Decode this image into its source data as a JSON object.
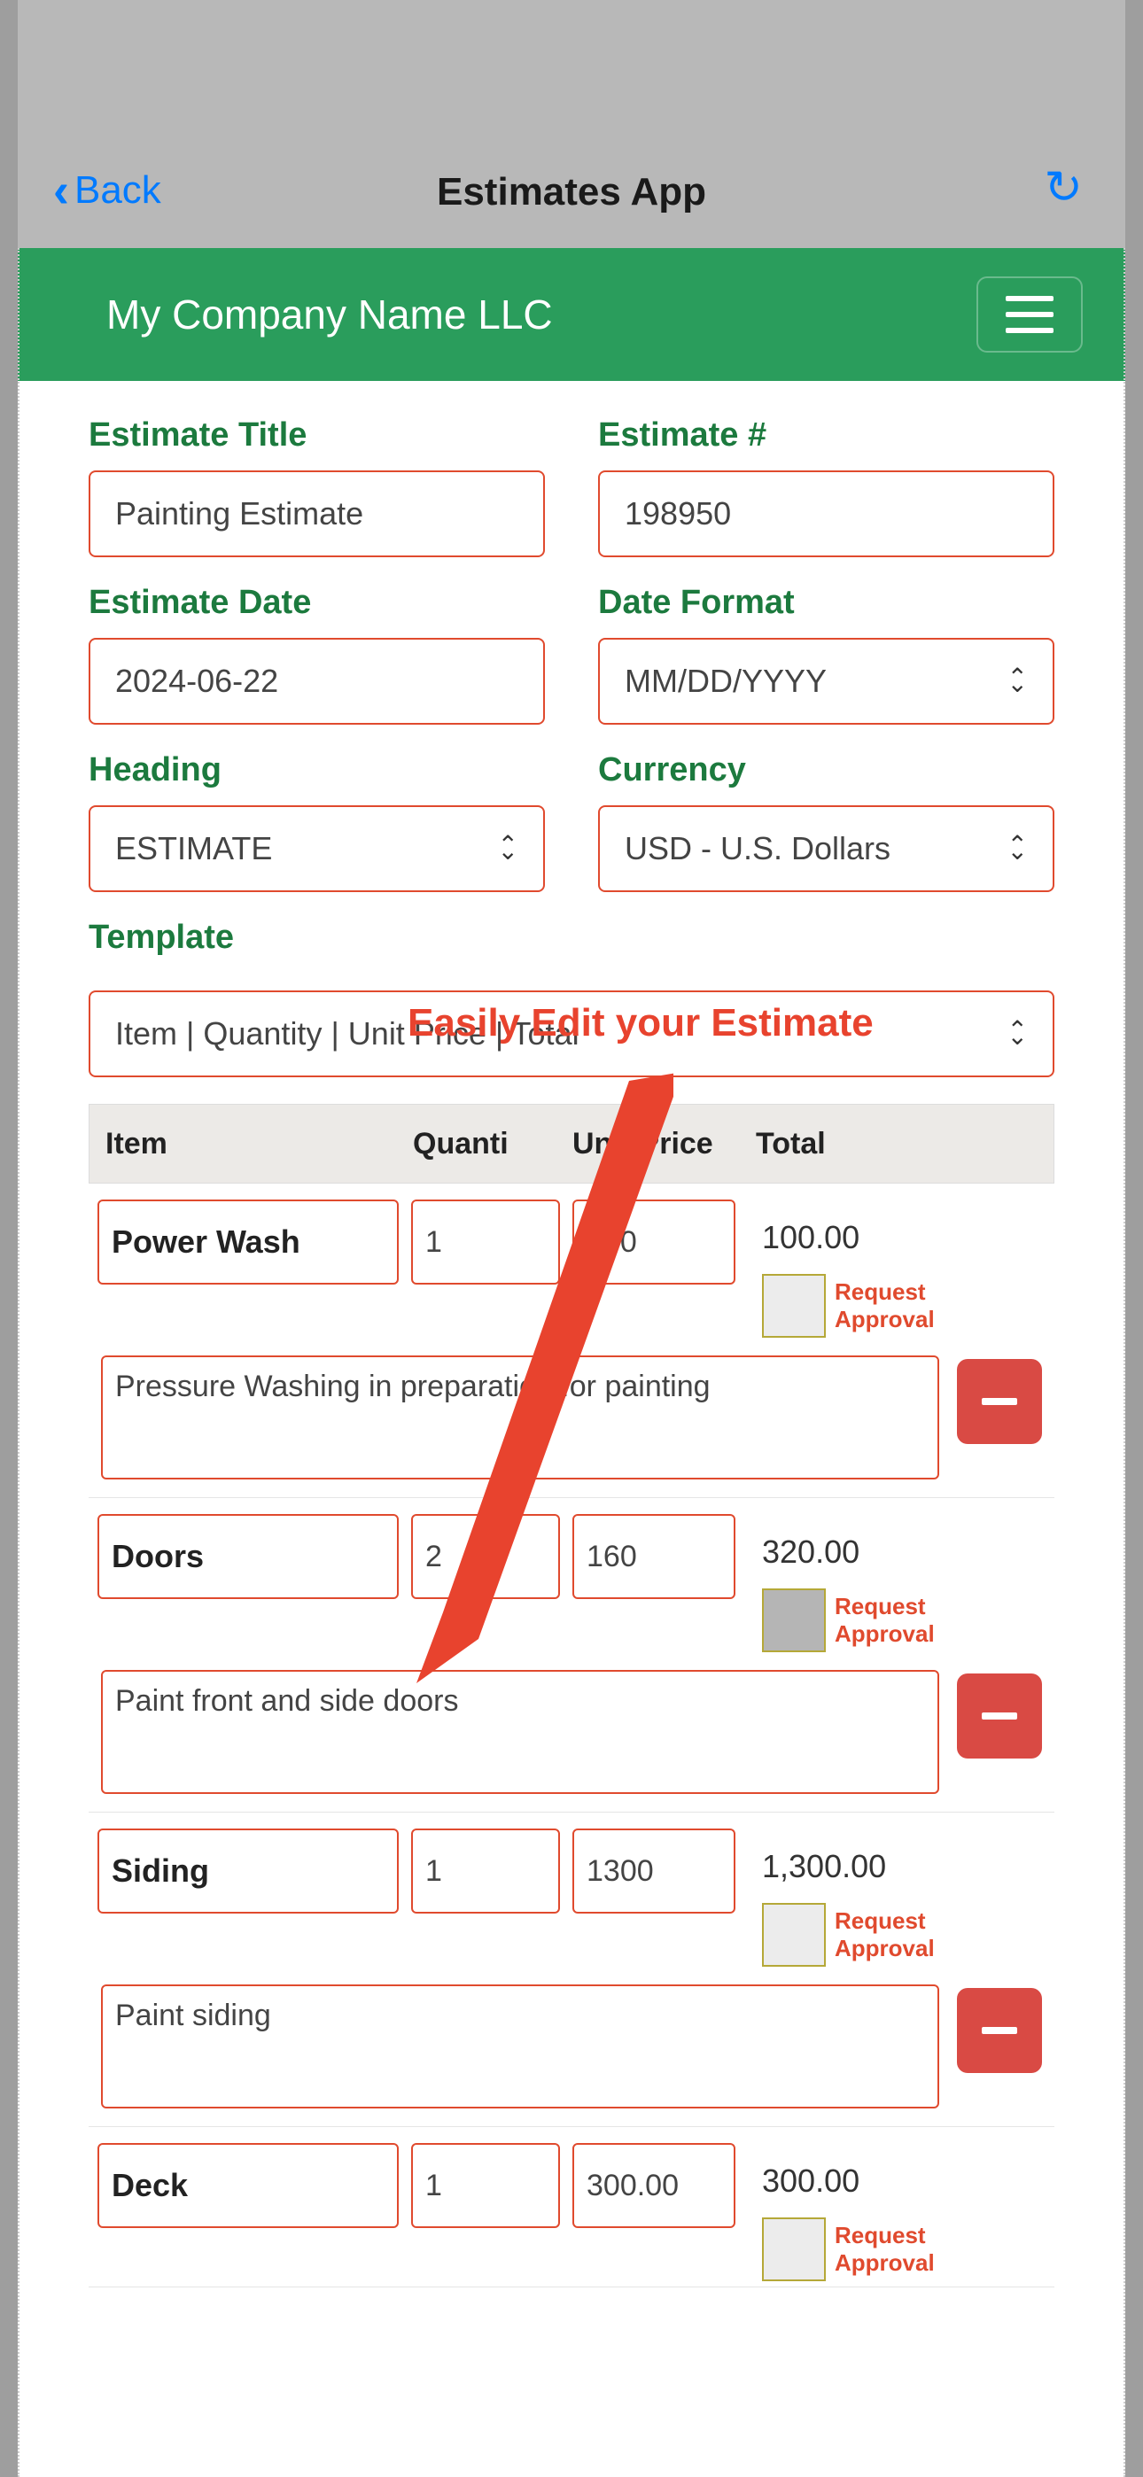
{
  "nav": {
    "back_label": "Back",
    "title": "Estimates App"
  },
  "header": {
    "company_name": "My Company Name LLC"
  },
  "annotation": {
    "text": "Easily Edit your Estimate"
  },
  "form": {
    "estimate_title": {
      "label": "Estimate Title",
      "value": "Painting Estimate"
    },
    "estimate_number": {
      "label": "Estimate #",
      "value": "198950"
    },
    "estimate_date": {
      "label": "Estimate Date",
      "value": "2024-06-22"
    },
    "date_format": {
      "label": "Date Format",
      "value": "MM/DD/YYYY"
    },
    "heading": {
      "label": "Heading",
      "value": "ESTIMATE"
    },
    "currency": {
      "label": "Currency",
      "value": "USD - U.S. Dollars"
    },
    "template": {
      "label": "Template",
      "value": "Item | Quantity | Unit Price | Total"
    }
  },
  "table": {
    "headers": {
      "item": "Item",
      "quantity": "Quanti",
      "unit_price": "Unit Price",
      "total": "Total"
    },
    "request_approval_label": "Request Approval",
    "rows": [
      {
        "item": "Power Wash",
        "quantity": "1",
        "unit_price": "100",
        "total": "100.00",
        "description": "Pressure Washing in preparation for painting"
      },
      {
        "item": "Doors",
        "quantity": "2",
        "unit_price": "160",
        "total": "320.00",
        "description": "Paint front and side doors"
      },
      {
        "item": "Siding",
        "quantity": "1",
        "unit_price": "1300",
        "total": "1,300.00",
        "description": "Paint siding"
      },
      {
        "item": "Deck",
        "quantity": "1",
        "unit_price": "300.00",
        "total": "300.00",
        "description": ""
      }
    ]
  },
  "colors": {
    "accent_green": "#2a9d5c",
    "label_green": "#1c7a3e",
    "border_red": "#e04a2e",
    "remove_red": "#d94a44",
    "ios_blue": "#007aff"
  }
}
